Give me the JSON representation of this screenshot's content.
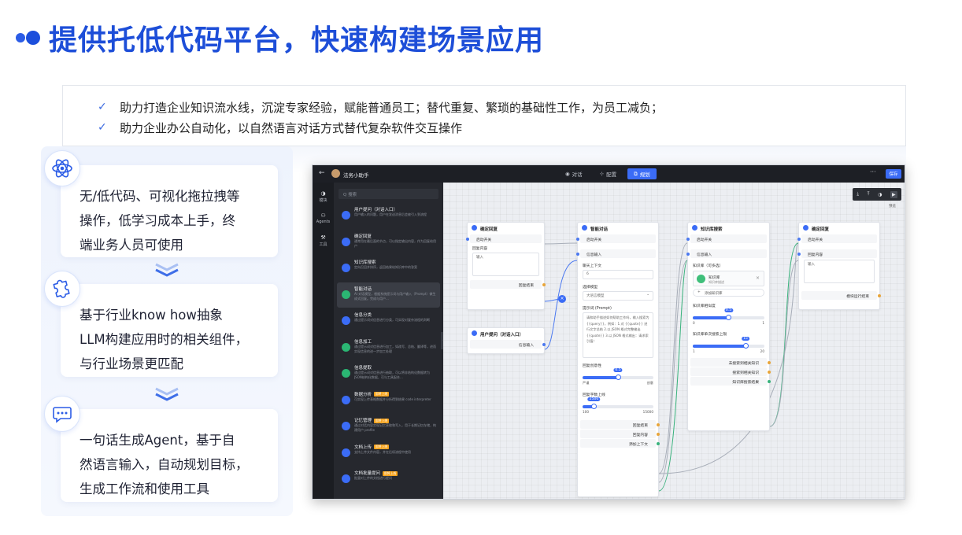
{
  "title": "提供托低代码平台，快速构建场景应用",
  "bullets": [
    "助力打造企业知识流水线，沉淀专家经验，赋能普通员工；替代重复、繁琐的基础性工作，为员工减负；",
    "助力企业办公自动化，以自然语言对话方式替代复杂软件交互操作"
  ],
  "check_glyph": "✓",
  "cards": [
    {
      "icon": "atom-icon",
      "lines": [
        "无/低代码、可视化拖拉拽等",
        "操作，低学习成本上手，终",
        "端业务人员可使用"
      ]
    },
    {
      "icon": "puzzle-icon",
      "lines": [
        "基于行业know how抽象",
        "LLM构建应用时的相关组件，",
        "与行业场景更匹配"
      ]
    },
    {
      "icon": "chat-icon",
      "lines": [
        "一句话生成Agent，基于自",
        "然语言输入，自动规划目标，",
        "生成工作流和使用工具"
      ]
    }
  ],
  "colors": {
    "brand": "#1d4ed8",
    "accent": "#3b6cf6",
    "tag": "#f6a21a",
    "dark_bg": "#1d1f25"
  },
  "app": {
    "back": "←",
    "name": "法务小助手",
    "tabs": [
      {
        "icon": "chat-bubble-icon",
        "label": "对话"
      },
      {
        "icon": "config-icon",
        "label": "配置"
      },
      {
        "icon": "plan-icon",
        "label": "规划"
      }
    ],
    "more": "···",
    "save": "保存",
    "rail": [
      {
        "icon": "◑",
        "label": "模块"
      },
      {
        "icon": "⚇",
        "label": "Agents"
      },
      {
        "icon": "⚒",
        "label": "工具"
      }
    ],
    "search_placeholder": "Q 搜索",
    "components": [
      {
        "title": "用户提问（对话入口）",
        "tag": "",
        "desc": "用户输入的问题，用户在发送消息后会被引入到流程"
      },
      {
        "title": "确定回复",
        "tag": "",
        "desc": "通常用在最后面的节点，可以指定输出内容，作为回复给用户"
      },
      {
        "title": "知识库搜索",
        "tag": "",
        "desc": "定向召回并排序，返回结果给知识库中的答案"
      },
      {
        "title": "智能对话",
        "tag": "",
        "desc": "AI 对话模型，根据系统提示词与用户输入（Prompt）做生成式回复。完成与用户…"
      },
      {
        "title": "信息分类",
        "tag": "",
        "desc": "通过提示词对信息进行分类，可实现对复杂流程的判断"
      },
      {
        "title": "信息加工",
        "tag": "",
        "desc": "通过提示词对信息进行加工，如改写、总结、翻译等，进而实现信息的进一步加工处理"
      },
      {
        "title": "信息提取",
        "tag": "",
        "desc": "通过提示词对信息进行抽取，可以将非结构化数据转为JSON结构化数据，可与工具配合…"
      },
      {
        "title": "数据分析",
        "tag": "即将上线",
        "desc": "可实现上传表格数据并分析得到结果 code interpreter"
      },
      {
        "title": "记忆管理",
        "tag": "即将上线",
        "desc": "通过对话内容实现记忆获取和写入，用于长期记忆存储，构建用户 profile"
      },
      {
        "title": "文档上传",
        "tag": "即将上线",
        "desc": "支持上传文件内容，并在后续流程中使用"
      },
      {
        "title": "文档批量提问",
        "tag": "即将上线",
        "desc": "批量对上传的文档进行提问"
      }
    ],
    "canvas_tools": [
      "⤓",
      "⤒",
      "◑",
      "▶"
    ],
    "canvas_label": "预览",
    "nodes": {
      "reply1": {
        "title": "确定回复",
        "start": "启动开关",
        "content_label": "回复内容",
        "placeholder": "输入",
        "out": "回复结束"
      },
      "user_q": {
        "title": "用户提问（对话入口）",
        "out": "信息输入"
      },
      "chat": {
        "title": "智能对话",
        "start": "启动开关",
        "in": "信息输入",
        "ctx_label": "聊天上下文",
        "ctx_value": "6",
        "model_label": "选择模型",
        "model_value": "大语言模型",
        "prompt_label": "提示词 (Prompt)",
        "prompt_text": "请和助手描述如何帮助工作吗，输入搜索为 {{query}}，例如：1.对 {{quote}} 进行文字总结 2.以 JSON 格式完整输出 {{quote}} 3.以 JSON 格式输出：请求索引值！",
        "temp_label": "回复创意性",
        "temp_value": 0.5,
        "temp_min": "严谨",
        "temp_max": "创意",
        "tokens_label": "回复字数上线",
        "tokens_value": 2500,
        "tokens_min": "100",
        "tokens_max": "15000",
        "out1": "回复结束",
        "out2": "回复内容",
        "out3": "添加上下文"
      },
      "kb": {
        "title": "知识库搜索",
        "start": "启动开关",
        "in": "信息输入",
        "kb_label": "知识库（可多选）",
        "kb_name": "知识库",
        "kb_sub": "知识库描述",
        "kb_close": "×",
        "add_kb": "添加知识库",
        "sim_label": "知识库相似度",
        "sim_value": 0.5,
        "sim_min": "0",
        "sim_max": "1",
        "limit_label": "知识库单次搜索上限",
        "limit_value": 15,
        "limit_min": "1",
        "limit_max": "20",
        "out1": "未搜索到相关知识",
        "out2": "搜索到相关知识",
        "out3": "知识库搜索结果"
      },
      "reply2": {
        "title": "确定回复",
        "start": "启动开关",
        "content_label": "回复内容",
        "placeholder": "输入",
        "out": "模块运行结束"
      }
    },
    "collapse": "‹",
    "x_marker": "×"
  }
}
